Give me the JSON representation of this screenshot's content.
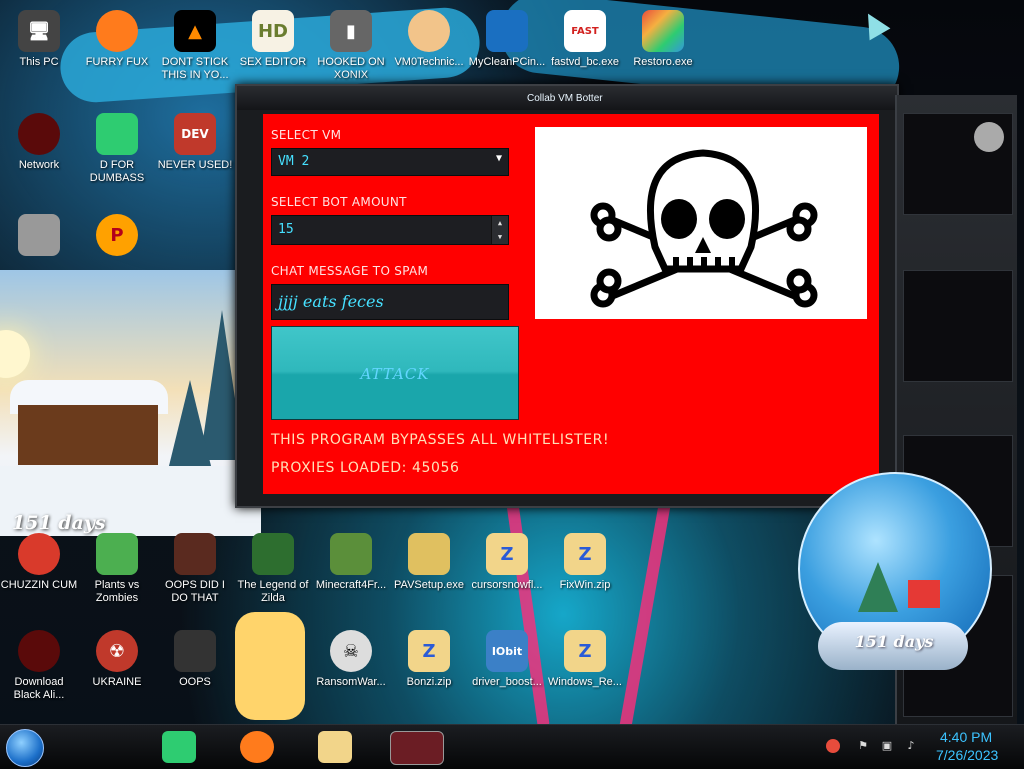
{
  "desktop": {
    "icons": [
      {
        "label": "This PC"
      },
      {
        "label": "FURRY FUX"
      },
      {
        "label": "DONT STICK THIS IN YO..."
      },
      {
        "label": "SEX EDITOR"
      },
      {
        "label": "HOOKED ON XONIX"
      },
      {
        "label": "VM0Technic..."
      },
      {
        "label": "MyCleanPCin..."
      },
      {
        "label": "fastvd_bc.exe"
      },
      {
        "label": "Restoro.exe"
      },
      {
        "label": "Network"
      },
      {
        "label": "D FOR DUMBASS"
      },
      {
        "label": "NEVER USED!"
      },
      {
        "label": "CHUZZIN CUM"
      },
      {
        "label": "Plants vs Zombies"
      },
      {
        "label": "OOPS DID I DO THAT"
      },
      {
        "label": "The Legend of Zilda"
      },
      {
        "label": "Minecraft4Fr..."
      },
      {
        "label": "PAVSetup.exe"
      },
      {
        "label": "cursorsnowfl..."
      },
      {
        "label": "FixWin.zip"
      },
      {
        "label": "Download Black Ali..."
      },
      {
        "label": "UKRAINE"
      },
      {
        "label": "OOPS"
      },
      {
        "label": "RansomWar..."
      },
      {
        "label": "Bonzi.zip"
      },
      {
        "label": "driver_boost..."
      },
      {
        "label": "Windows_Re..."
      }
    ]
  },
  "snow_widget": {
    "days": "151 days"
  },
  "app": {
    "title": "Collab VM Botter",
    "select_vm_label": "SELECT VM",
    "select_vm_value": "VM 2",
    "bot_amount_label": "SELECT BOT AMOUNT",
    "bot_amount_value": "15",
    "chat_label": "CHAT MESSAGE TO SPAM",
    "chat_value": "jjjj eats feces",
    "attack_label": "ATTACK",
    "notice": "THIS PROGRAM BYPASSES ALL WHITELISTER!",
    "proxies": "PROXIES LOADED: 45056",
    "skull_icon": "skull-crossbones-icon"
  },
  "globe": {
    "days": "151 days"
  },
  "taskbar": {
    "apps": [
      "spotify-icon",
      "firefox-icon",
      "file-explorer-icon",
      "window-thumbnail-icon"
    ],
    "time": "4:40 PM",
    "date": "7/26/2023"
  },
  "colors": {
    "window_bg": "#ff0000",
    "accent": "#3cc3ff",
    "attack": "#2fb8bc"
  }
}
